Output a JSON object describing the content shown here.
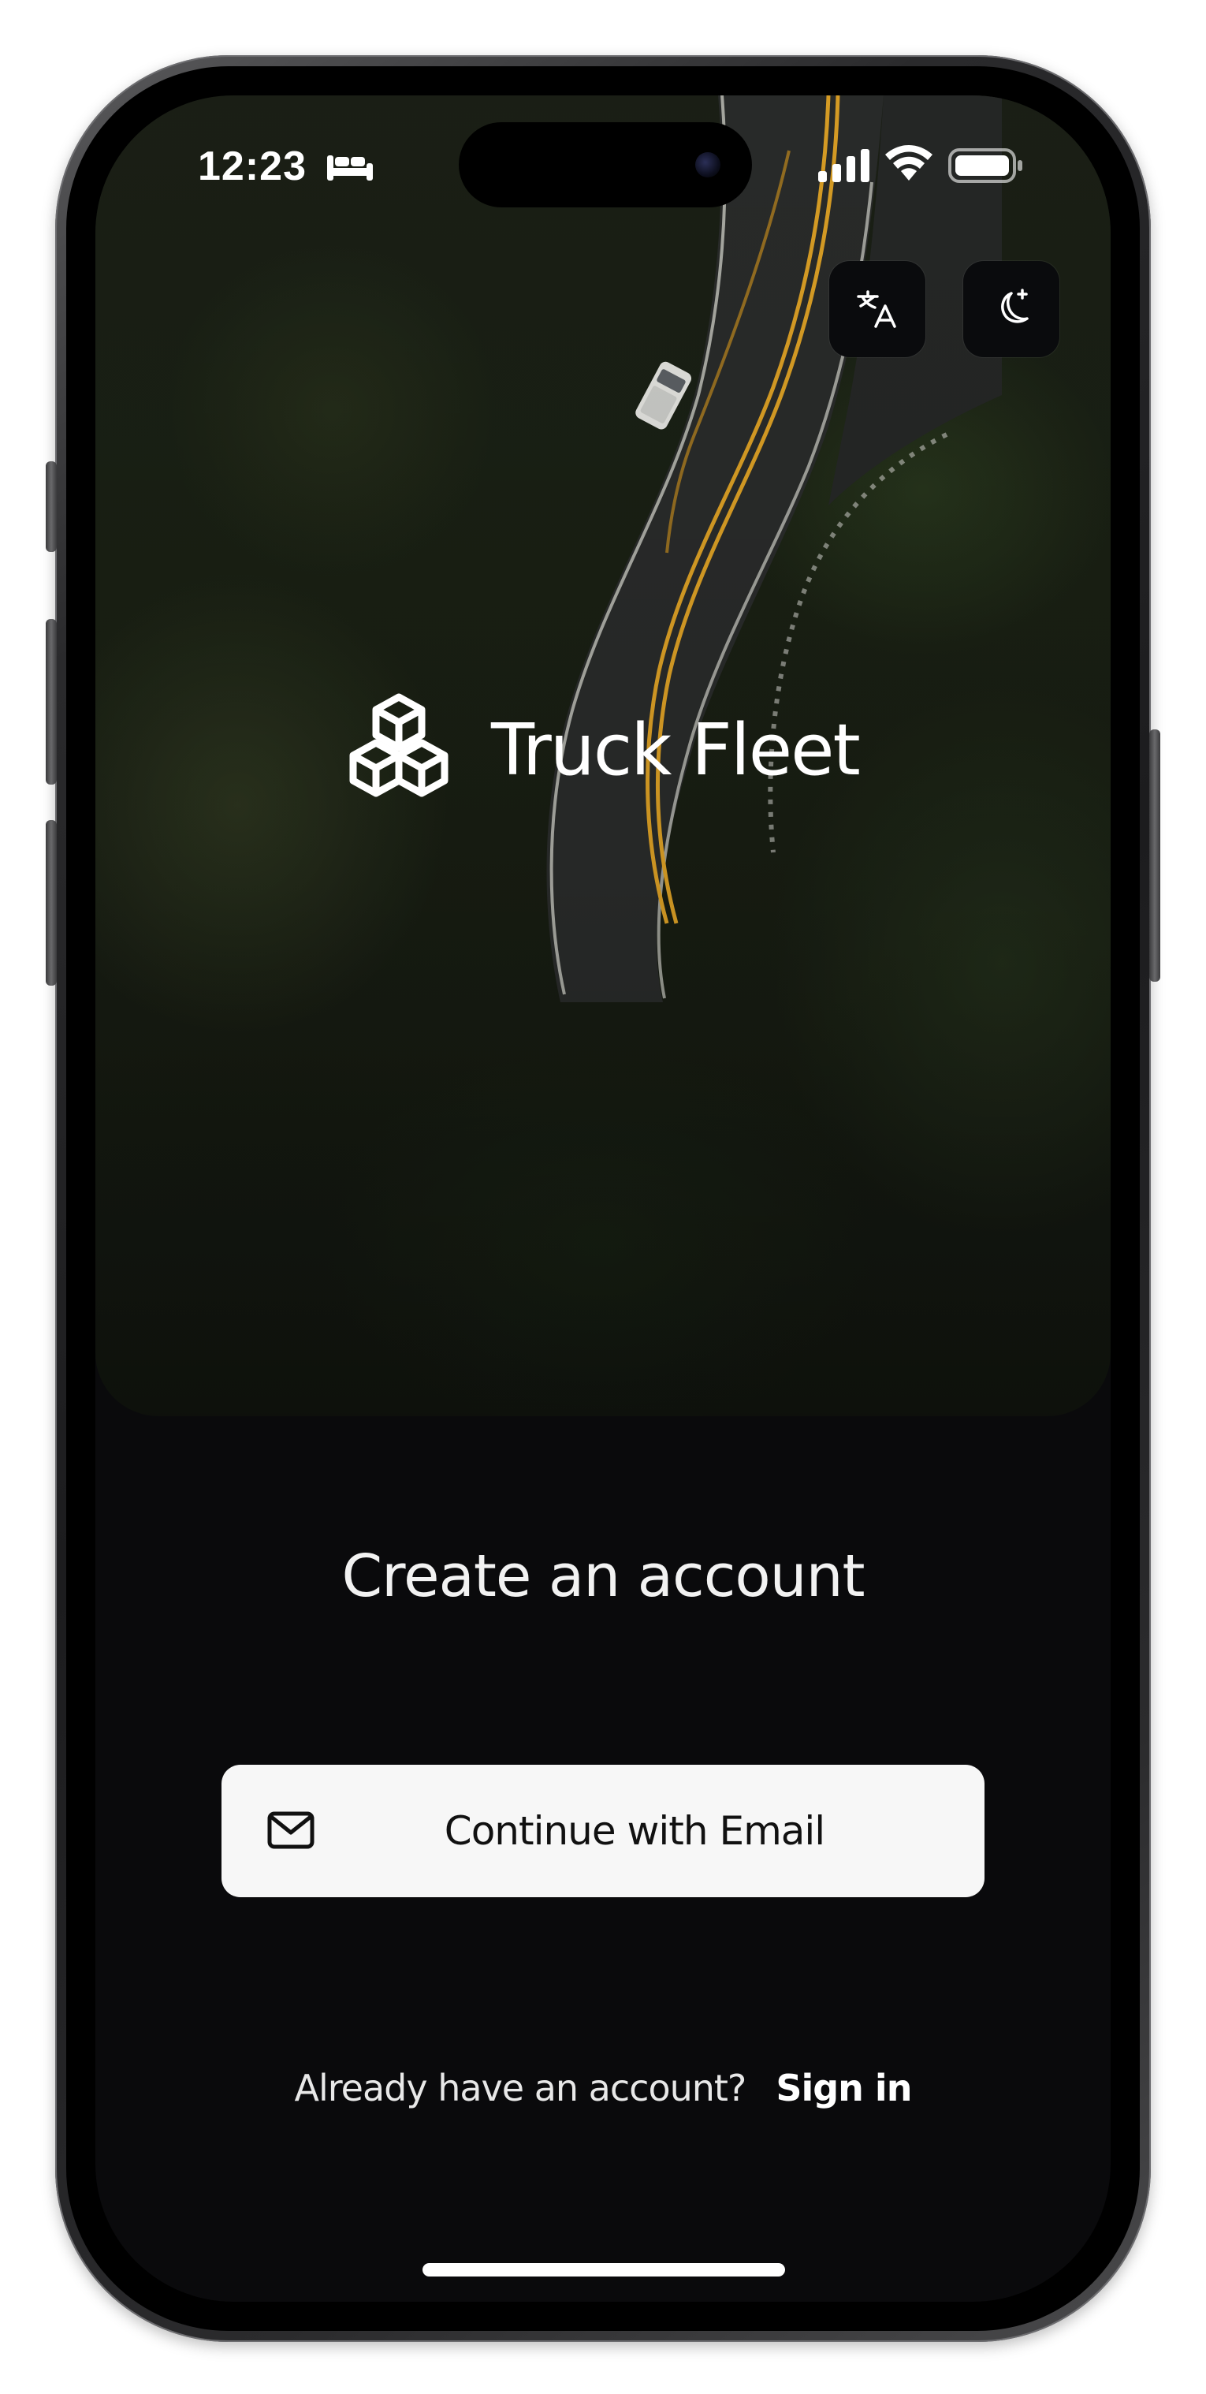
{
  "status_bar": {
    "time": "12:23",
    "focus_icon": "bed-icon",
    "signal_icon": "cellular-signal-icon",
    "wifi_icon": "wifi-icon",
    "battery_icon": "battery-icon"
  },
  "header_actions": {
    "translate_icon": "translate-icon",
    "theme_icon": "moon-icon"
  },
  "brand": {
    "name": "Truck Fleet",
    "logo_icon": "cubes-logo-icon"
  },
  "main": {
    "headline": "Create an account",
    "email_button_label": "Continue with Email",
    "email_icon": "mail-icon",
    "signin_prompt": "Already have an account?",
    "signin_link": "Sign in"
  },
  "colors": {
    "background": "#0a0a0c",
    "button_background": "#f7f7f7",
    "text_primary": "#ffffff",
    "road_line": "#e0a326"
  }
}
